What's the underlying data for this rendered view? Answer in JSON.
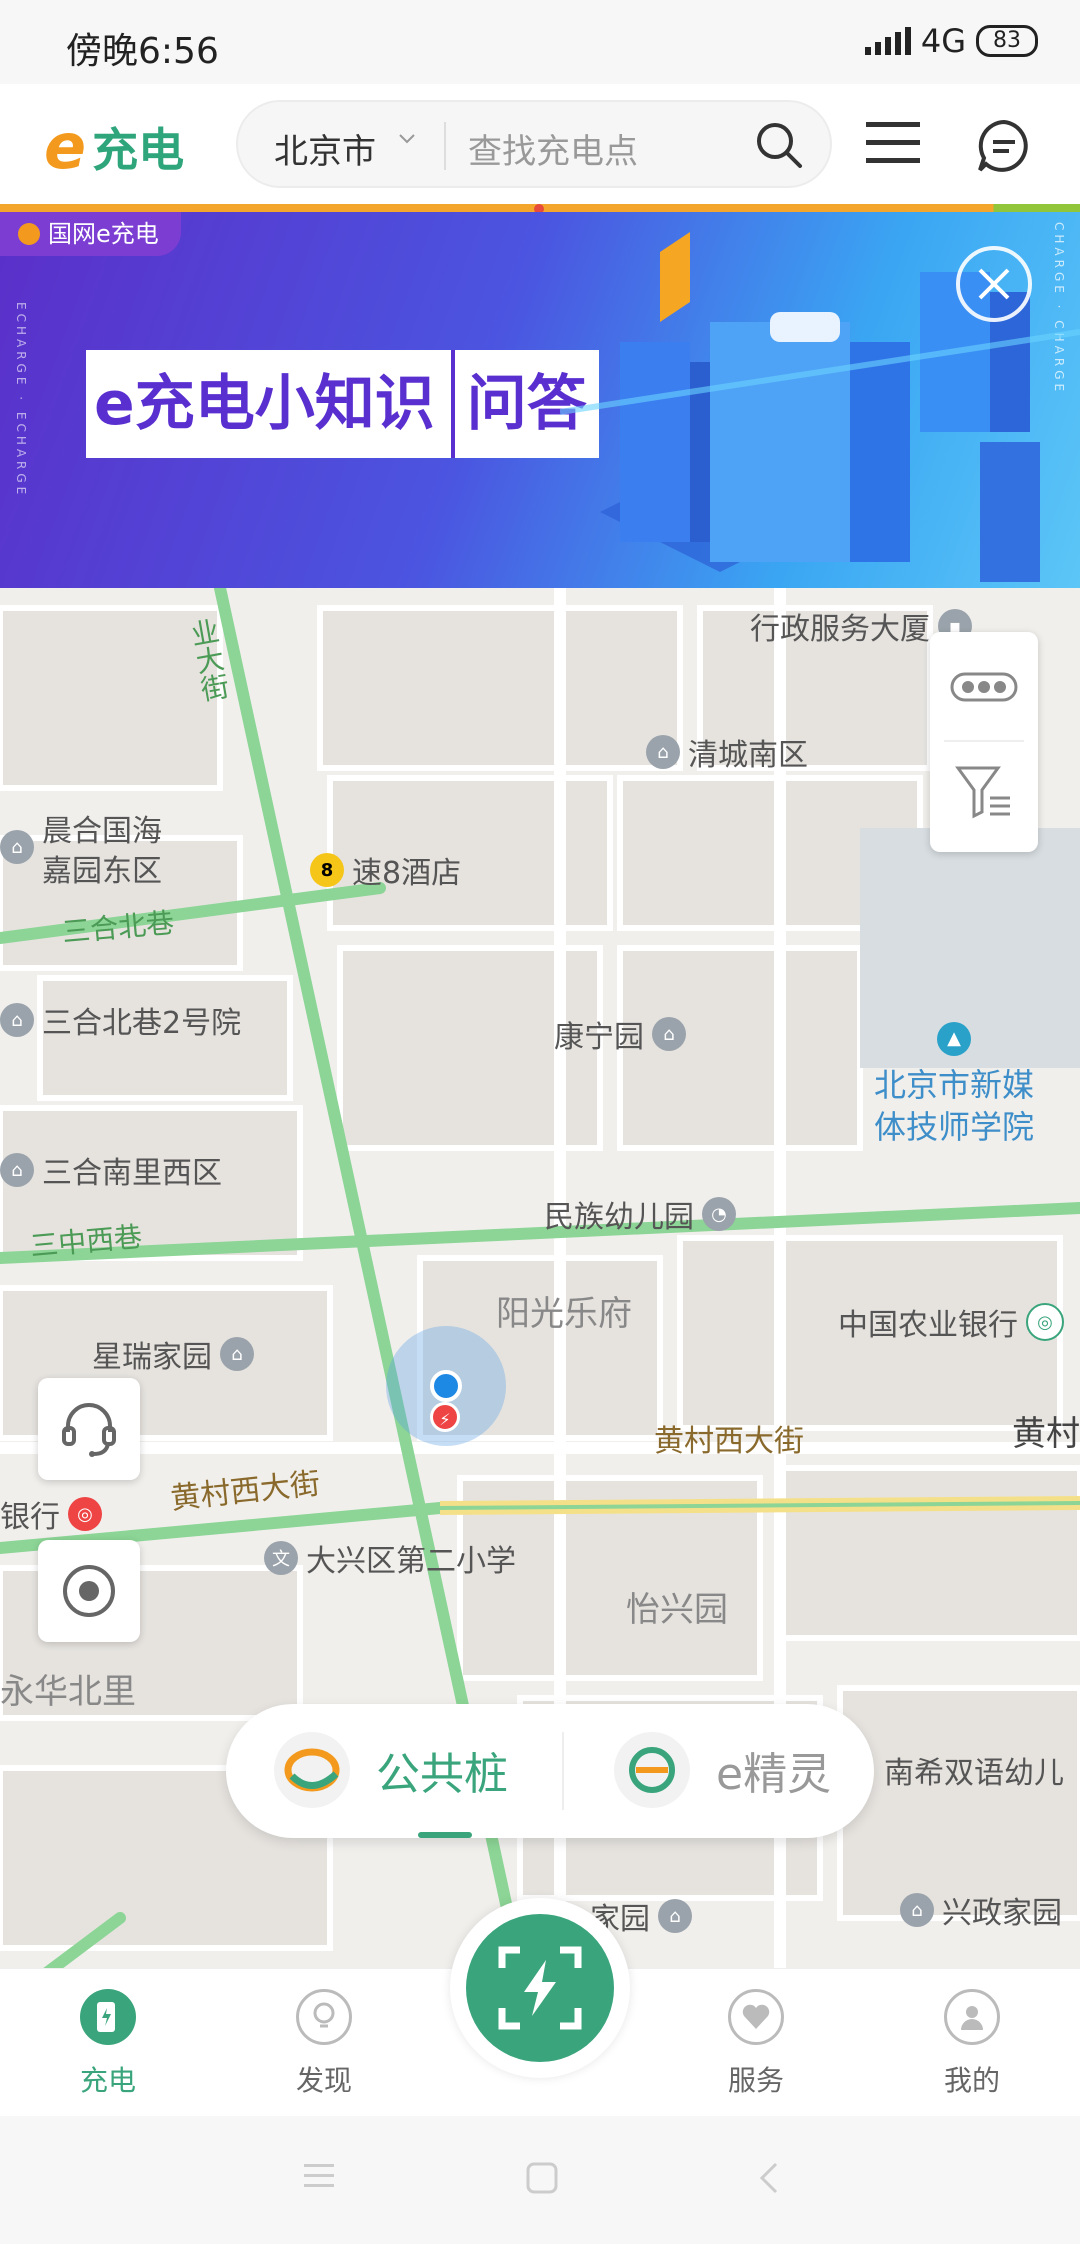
{
  "status_bar": {
    "time": "傍晚6:56",
    "network": "4G",
    "battery": "83"
  },
  "header": {
    "logo_e": "e",
    "logo_text": "充电",
    "city": "北京市",
    "search_placeholder": "查找充电点"
  },
  "banner": {
    "tag": "国网e充电",
    "title_left": "e充电小知识",
    "title_right": "问答",
    "side_text": "ECHARGE · ECHARGE",
    "side_text_right": "CHARGE · CHARGE"
  },
  "map": {
    "pois": [
      {
        "name": "行政服务大厦"
      },
      {
        "name": "清城南区"
      },
      {
        "name": "晨合国海\n嘉园东区"
      },
      {
        "name": "速8酒店"
      },
      {
        "name": "三合北巷2号院"
      },
      {
        "name": "康宁园"
      },
      {
        "name": "北京市新媒\n体技师学院"
      },
      {
        "name": "三合南里西区"
      },
      {
        "name": "民族幼儿园"
      },
      {
        "name": "阳光乐府"
      },
      {
        "name": "中国农业银行"
      },
      {
        "name": "星瑞家园"
      },
      {
        "name": "黄村"
      },
      {
        "name": "大兴区第二小学"
      },
      {
        "name": "怡兴园"
      },
      {
        "name": "永华北里"
      },
      {
        "name": "南希双语幼儿"
      },
      {
        "name": "兴政家园"
      },
      {
        "name": "家园"
      },
      {
        "name": "银行"
      }
    ],
    "roads": {
      "north_road": "业大街",
      "sanhe_beixiang": "三合北巷",
      "sanzhong_xixiang": "三中西巷",
      "huangcun_xidajie_1": "黄村西大街",
      "huangcun_xidajie_2": "黄村西大街"
    }
  },
  "mode_toggle": {
    "items": [
      {
        "label": "公共桩",
        "active": true
      },
      {
        "label": "e精灵",
        "active": false
      }
    ]
  },
  "tabbar": {
    "items": [
      {
        "label": "充电",
        "active": true
      },
      {
        "label": "发现",
        "active": false
      },
      {
        "label": "服务",
        "active": false
      },
      {
        "label": "我的",
        "active": false
      }
    ]
  },
  "colors": {
    "brand_green": "#3aa57c",
    "brand_orange": "#f39a1e",
    "road_green": "#7fd08a"
  }
}
